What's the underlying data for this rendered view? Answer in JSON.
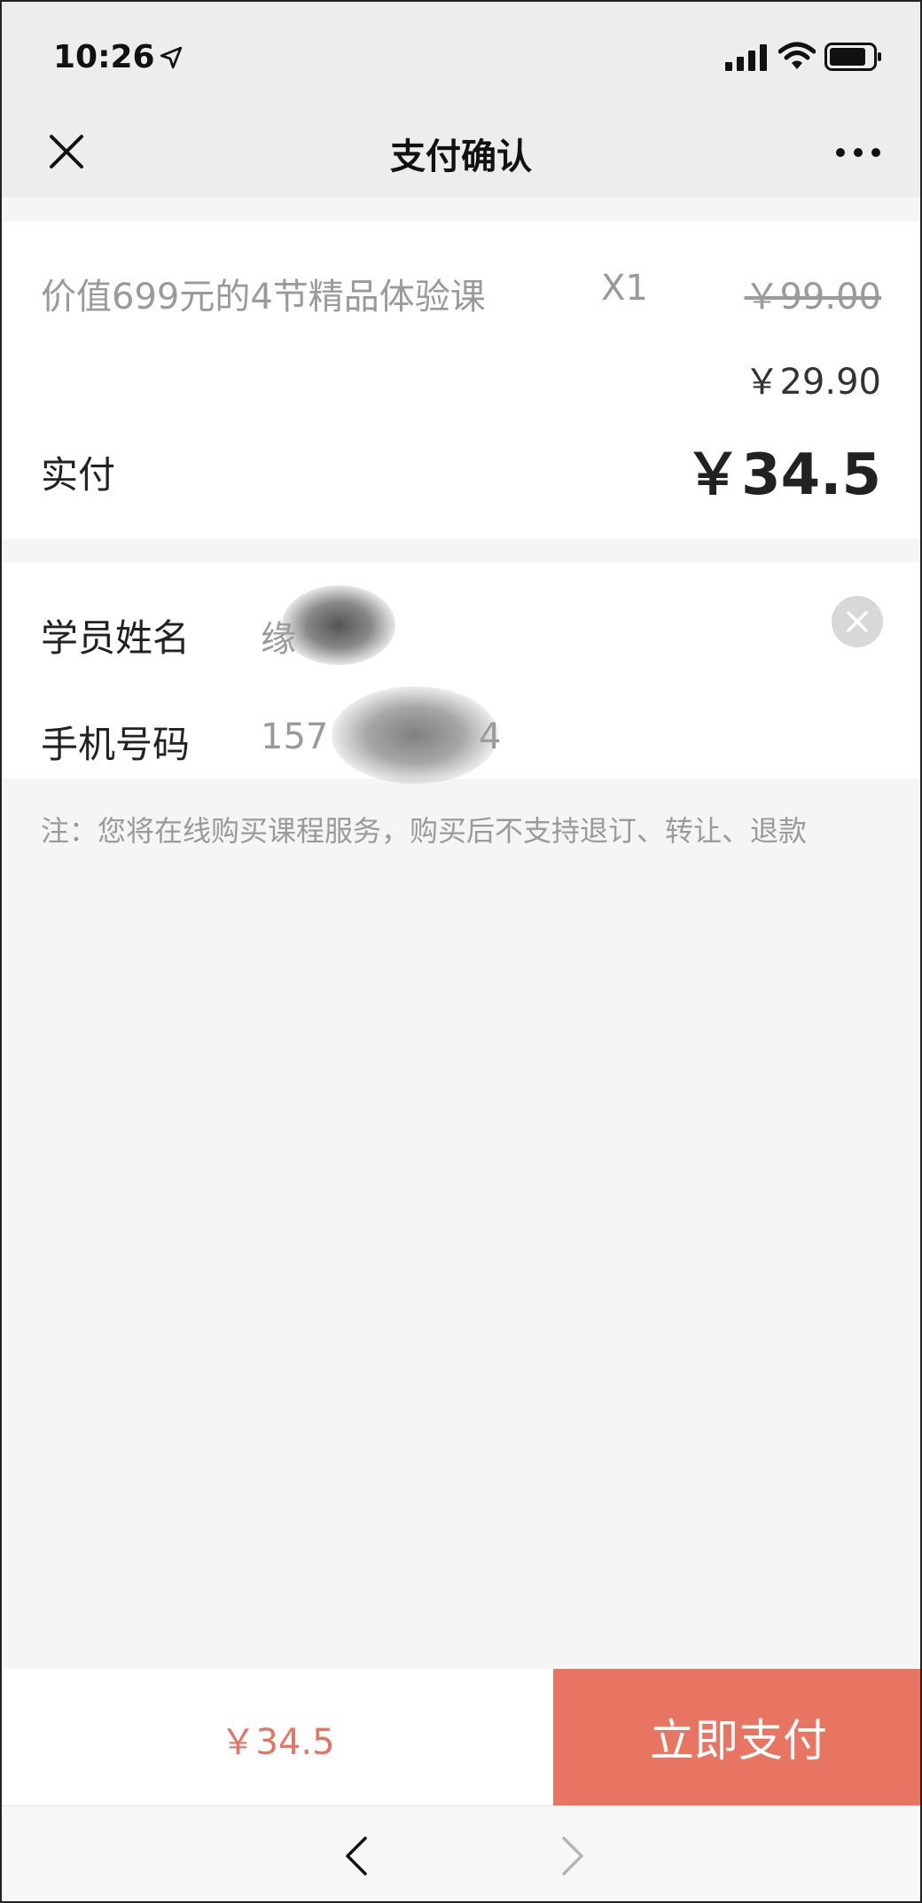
{
  "status_bar": {
    "time": "10:26",
    "icons": [
      "location-arrow-icon",
      "signal-icon",
      "wifi-icon",
      "battery-icon"
    ]
  },
  "nav": {
    "title": "支付确认",
    "left_icon": "close-icon",
    "right_icon": "more-icon"
  },
  "order": {
    "course_name": "价值699元的4节精品体验课",
    "quantity": "X1",
    "original_price": "￥99.00",
    "discount_price": "￥29.90",
    "paid_label": "实付",
    "paid_amount": "￥34.5"
  },
  "form": {
    "student_name_label": "学员姓名",
    "student_name_value": "缘",
    "phone_label": "手机号码",
    "phone_prefix": "157",
    "phone_suffix": "4",
    "clear_icon": "clear-icon"
  },
  "note": "注：您将在线购买课程服务，购买后不支持退订、转让、退款",
  "pay_bar": {
    "total": "￥34.5",
    "button_label": "立即支付"
  },
  "browser_nav": {
    "icons": [
      "back-arrow-icon",
      "forward-arrow-icon"
    ]
  },
  "colors": {
    "accent": "#e87462",
    "price_text": "#e47563",
    "background": "#f5f5f5",
    "header_bg": "#ededed"
  }
}
